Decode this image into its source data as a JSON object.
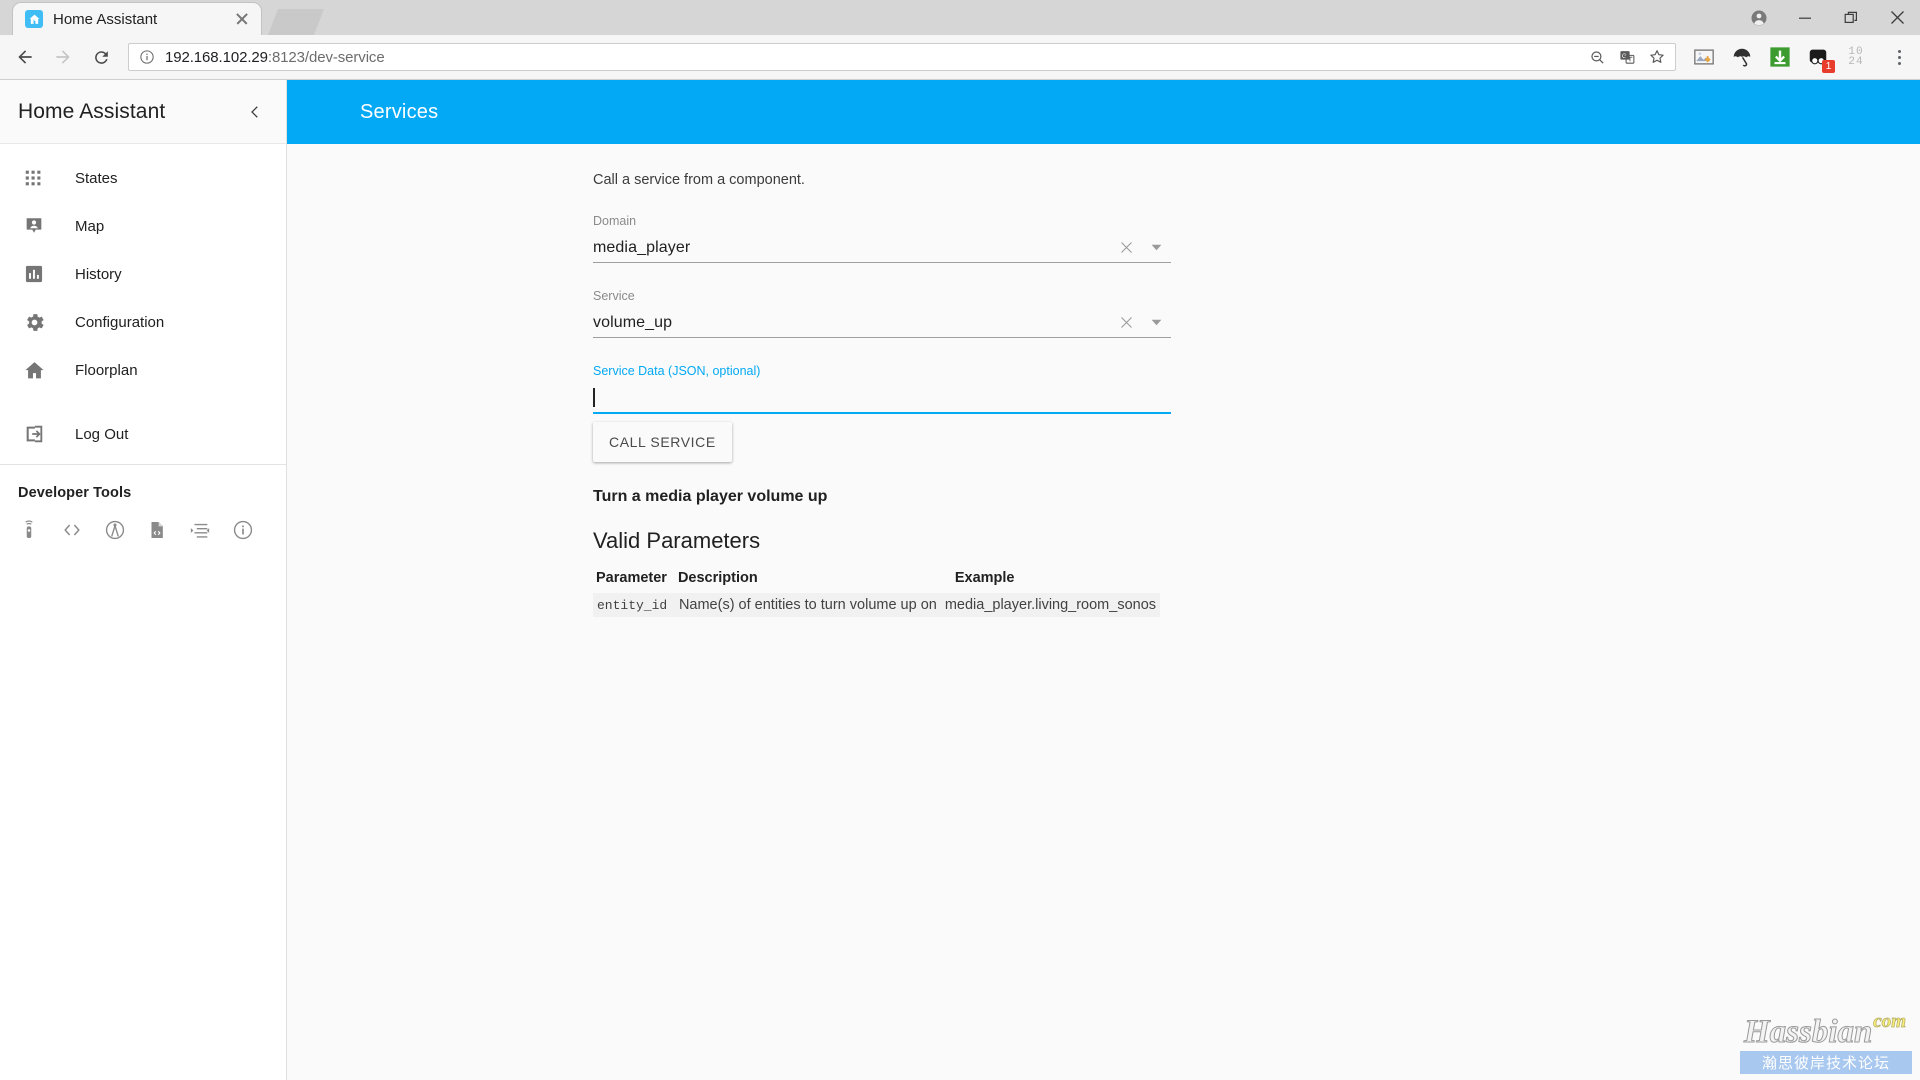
{
  "browser": {
    "tab": {
      "title": "Home Assistant",
      "favicon_icon": "home-assistant-logo-icon",
      "close_icon": "close-icon"
    },
    "window_controls": {
      "profile_icon": "account-circle-icon",
      "minimize_icon": "minimize-icon",
      "maximize_icon": "restore-icon",
      "close_icon": "close-icon"
    },
    "toolbar": {
      "back_icon": "back-arrow-icon",
      "forward_icon": "forward-arrow-icon",
      "reload_icon": "reload-icon",
      "info_icon": "page-info-icon",
      "url_host": "192.168.102.29",
      "url_rest": ":8123/dev-service",
      "url_full": "192.168.102.29:8123/dev-service",
      "omnibox_actions": [
        "zoom-out-icon",
        "translate-icon",
        "bookmark-star-icon"
      ],
      "extensions": [
        {
          "name": "image-download-extension-icon"
        },
        {
          "name": "umbrella-extension-icon"
        },
        {
          "name": "download-manager-icon"
        },
        {
          "name": "adblock-extension-icon",
          "badge": "1"
        },
        {
          "name": "ten24-extension-icon",
          "line1": "10",
          "line2": "24"
        }
      ],
      "menu_icon": "kebab-menu-icon"
    }
  },
  "sidebar": {
    "title": "Home Assistant",
    "collapse_icon": "chevron-left-icon",
    "items": [
      {
        "label": "States",
        "icon": "apps-grid-icon"
      },
      {
        "label": "Map",
        "icon": "map-marker-account-icon"
      },
      {
        "label": "History",
        "icon": "chart-box-icon"
      },
      {
        "label": "Configuration",
        "icon": "cog-icon"
      },
      {
        "label": "Floorplan",
        "icon": "home-icon"
      }
    ],
    "logout": {
      "label": "Log Out",
      "icon": "logout-icon"
    },
    "section_title": "Developer Tools",
    "dev_tools": [
      {
        "icon": "remote-services-icon"
      },
      {
        "icon": "code-brackets-states-icon"
      },
      {
        "icon": "broadcast-events-icon"
      },
      {
        "icon": "file-code-templates-icon"
      },
      {
        "icon": "mqtt-arrow-icon"
      },
      {
        "icon": "information-outline-icon"
      }
    ]
  },
  "app_bar": {
    "title": "Services"
  },
  "main": {
    "intro": "Call a service from a component.",
    "domain_field": {
      "label": "Domain",
      "value": "media_player",
      "clear_icon": "close-icon",
      "dropdown_icon": "chevron-down-icon"
    },
    "service_field": {
      "label": "Service",
      "value": "volume_up",
      "clear_icon": "close-icon",
      "dropdown_icon": "chevron-down-icon"
    },
    "service_data_field": {
      "label": "Service Data (JSON, optional)",
      "value": "",
      "focused": true
    },
    "call_button": "CALL SERVICE",
    "service_description": "Turn a media player volume up",
    "params_heading": "Valid Parameters",
    "params_table": {
      "headers": [
        "Parameter",
        "Description",
        "Example"
      ],
      "rows": [
        {
          "parameter": "entity_id",
          "description": "Name(s) of entities to turn volume up on",
          "example": "media_player.living_room_sonos"
        }
      ]
    }
  },
  "watermark": {
    "main": "Hassbian",
    "com": "com",
    "sub": "瀚思彼岸技术论坛"
  },
  "colors": {
    "accent": "#03a9f4",
    "tab_strip": "#d6d6d6",
    "page_bg": "#fafafa",
    "badge_red": "#e83c2d"
  }
}
